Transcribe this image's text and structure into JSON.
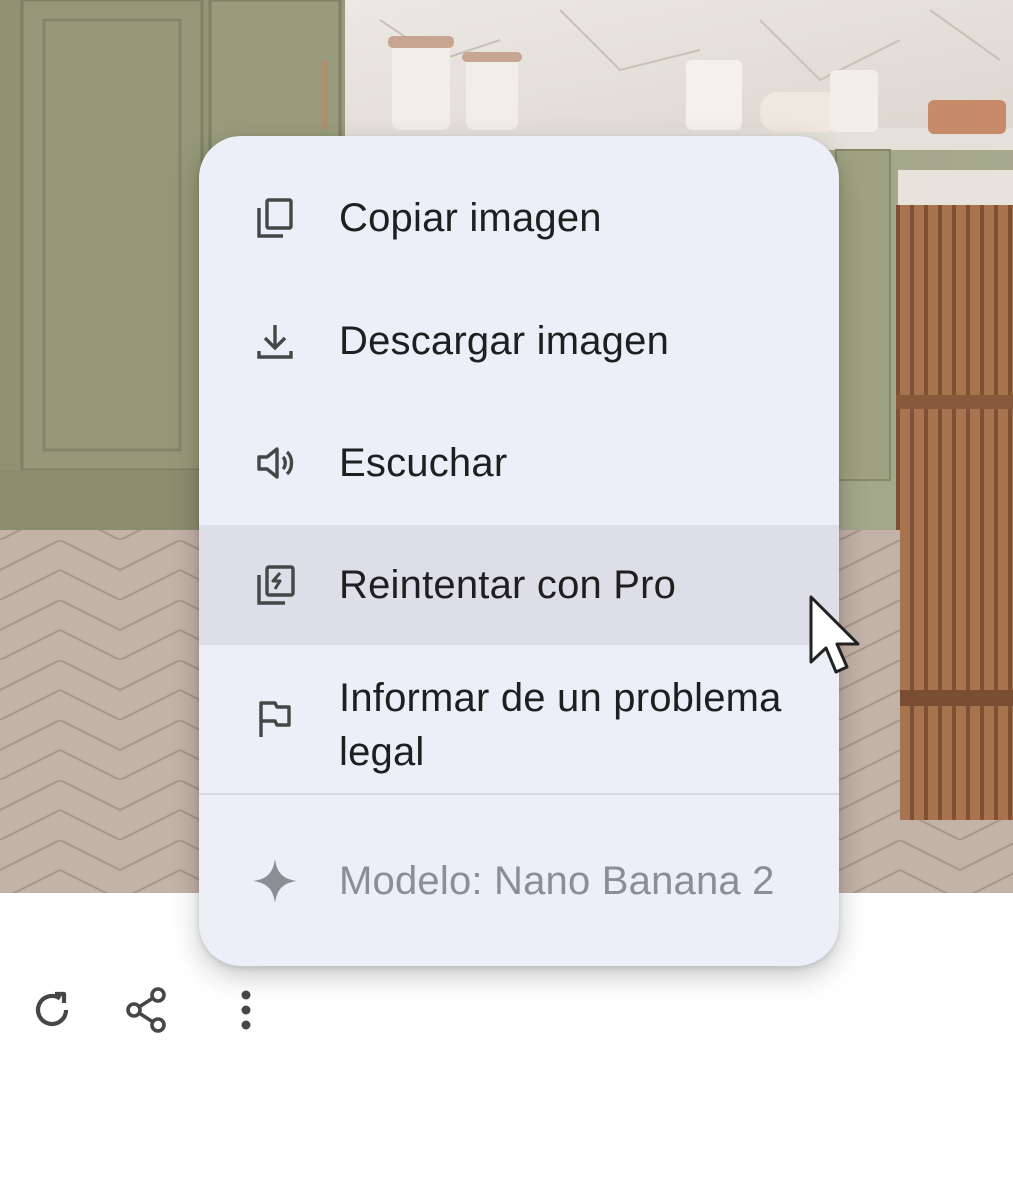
{
  "background_image": {
    "description_icon": "kitchen-scene-image"
  },
  "menu": {
    "items": [
      {
        "label": "Copiar imagen",
        "icon": "copy-icon"
      },
      {
        "label": "Descargar imagen",
        "icon": "download-icon"
      },
      {
        "label": "Escuchar",
        "icon": "speaker-icon"
      },
      {
        "label": "Reintentar con Pro",
        "icon": "retry-pro-icon"
      },
      {
        "label": "Informar de un problema legal",
        "icon": "flag-icon"
      }
    ],
    "model_label": "Modelo: Nano Banana 2",
    "model_icon": "sparkle-icon",
    "highlighted_index": 3
  },
  "actions": [
    {
      "icon": "refresh-icon"
    },
    {
      "icon": "share-icon"
    },
    {
      "icon": "more-vertical-icon"
    }
  ],
  "colors": {
    "menu_bg": "#eceef8",
    "highlight_bg": "#dedee8",
    "text": "#1f1f1f",
    "muted_text": "#8c8d95",
    "icon": "#444746"
  }
}
